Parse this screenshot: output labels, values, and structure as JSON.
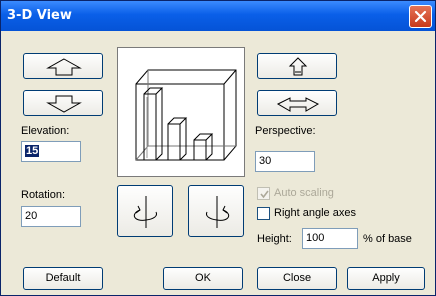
{
  "window": {
    "title": "3-D View"
  },
  "fields": {
    "elevation": {
      "label": "Elevation:",
      "value": "15"
    },
    "rotation": {
      "label": "Rotation:",
      "value": "20"
    },
    "perspective": {
      "label": "Perspective:",
      "value": "30"
    },
    "height": {
      "label": "Height:",
      "value": "100",
      "suffix": "% of base"
    }
  },
  "checkboxes": {
    "auto_scaling": {
      "label": "Auto scaling",
      "checked": true,
      "disabled": true
    },
    "right_angle_axes": {
      "label": "Right angle axes",
      "checked": false,
      "disabled": false
    }
  },
  "buttons": {
    "default": "Default",
    "ok": "OK",
    "close": "Close",
    "apply": "Apply"
  },
  "icons": {
    "elevation_up": "arrow-up-icon",
    "elevation_down": "arrow-down-icon",
    "perspective_up": "perspective-up-icon",
    "perspective_down": "perspective-down-icon",
    "rotate_left": "rotate-left-icon",
    "rotate_right": "rotate-right-icon",
    "close": "close-icon"
  }
}
